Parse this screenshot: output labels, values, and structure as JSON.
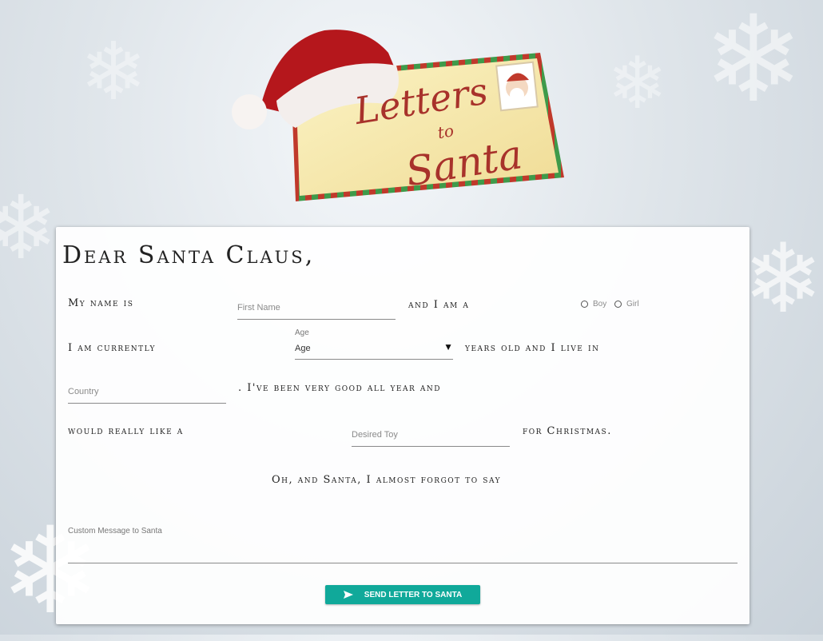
{
  "logo": {
    "line1": "Letters",
    "line2": "to",
    "line3": "Santa"
  },
  "letter": {
    "heading": "Dear Santa Claus,",
    "my_name_is": "My name is",
    "and_i_am_a": "and I am a",
    "i_am_currently": "I am currently",
    "years_old": "years old and I live in",
    "been_good": ". I've been very good all year and",
    "would_like": "would really like a",
    "for_christmas": "for Christmas.",
    "oh_and_santa": "Oh, and Santa, I almost forgot to say"
  },
  "form": {
    "first_name_placeholder": "First Name",
    "gender_options": [
      "Boy",
      "Girl"
    ],
    "age_label": "Age",
    "age_value": "Age",
    "country_placeholder": "Country",
    "toy_placeholder": "Desired Toy",
    "message_label": "Custom Message to Santa",
    "send_label": "SEND LETTER TO SANTA"
  },
  "colors": {
    "send_button": "#10a99a"
  }
}
